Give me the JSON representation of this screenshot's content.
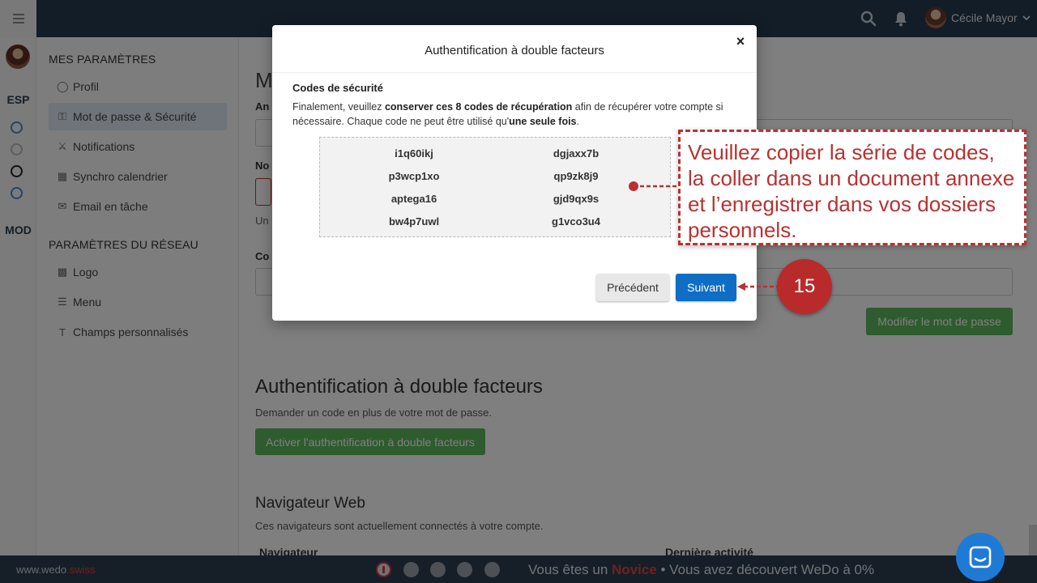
{
  "topbar": {
    "user_name": "Cécile Mayor",
    "search_icon": "search-icon",
    "bell_icon": "bell-icon"
  },
  "rail": {
    "section_esp": "ESP",
    "section_mod": "MOD"
  },
  "settings": {
    "heading_my": "MES PARAMÈTRES",
    "items_my": [
      {
        "label": "Profil",
        "icon": "user-icon"
      },
      {
        "label": "Mot de passe & Sécurité",
        "icon": "key-icon"
      },
      {
        "label": "Notifications",
        "icon": "bell-icon"
      },
      {
        "label": "Synchro calendrier",
        "icon": "calendar-icon"
      },
      {
        "label": "Email en tâche",
        "icon": "envelope-icon"
      }
    ],
    "heading_network": "PARAMÈTRES DU RÉSEAU",
    "items_network": [
      {
        "label": "Logo",
        "icon": "building-icon"
      },
      {
        "label": "Menu",
        "icon": "bars-icon"
      },
      {
        "label": "Champs personnalisés",
        "icon": "text-icon"
      }
    ]
  },
  "main": {
    "title_fragment": "M",
    "label_fragment_1": "An",
    "label_fragment_2": "No",
    "help_fragment": "Un",
    "label_fragment_3": "Co",
    "modify_button": "Modifier le mot de passe",
    "twofa_title": "Authentification à double facteurs",
    "twofa_desc": "Demander un code en plus de votre mot de passe.",
    "twofa_button": "Activer l'authentification à double facteurs",
    "browser_title": "Navigateur Web",
    "browser_desc": "Ces navigateurs sont actuellement connectés à votre compte.",
    "col_browser": "Navigateur",
    "col_last_activity": "Dernière activité"
  },
  "modal": {
    "title": "Authentification à double facteurs",
    "close": "×",
    "codes_heading": "Codes de sécurité",
    "desc_part1": "Finalement, veuillez ",
    "desc_bold1": "conserver ces 8 codes de récupération",
    "desc_part2": " afin de récupérer votre compte si nécessaire. Chaque code ne peut être utilisé qu'",
    "desc_bold2": "une seule fois",
    "desc_part3": ".",
    "codes": [
      "i1q60ikj",
      "dgjaxx7b",
      "p3wcp1xo",
      "qp9zk8j9",
      "aptega16",
      "gjd9qx9s",
      "bw4p7uwl",
      "g1vco3u4"
    ],
    "prev_button": "Précédent",
    "next_button": "Suivant"
  },
  "tutorial": {
    "callout_text": "Veuillez copier la série de codes, la coller dans un document annexe et l’enregistrer dans vos dossiers personnels.",
    "step_number": "15"
  },
  "statusbar": {
    "brand_main": "www.wedo",
    "brand_suffix": ".swiss",
    "status_prefix": "Vous êtes un ",
    "status_level": "Novice",
    "status_suffix": " • Vous avez découvert WeDo à 0%"
  },
  "colors": {
    "topbar": "#253a4f",
    "primary": "#0e6ec6",
    "success": "#5cb85c",
    "tutorial_red": "#b83232"
  }
}
